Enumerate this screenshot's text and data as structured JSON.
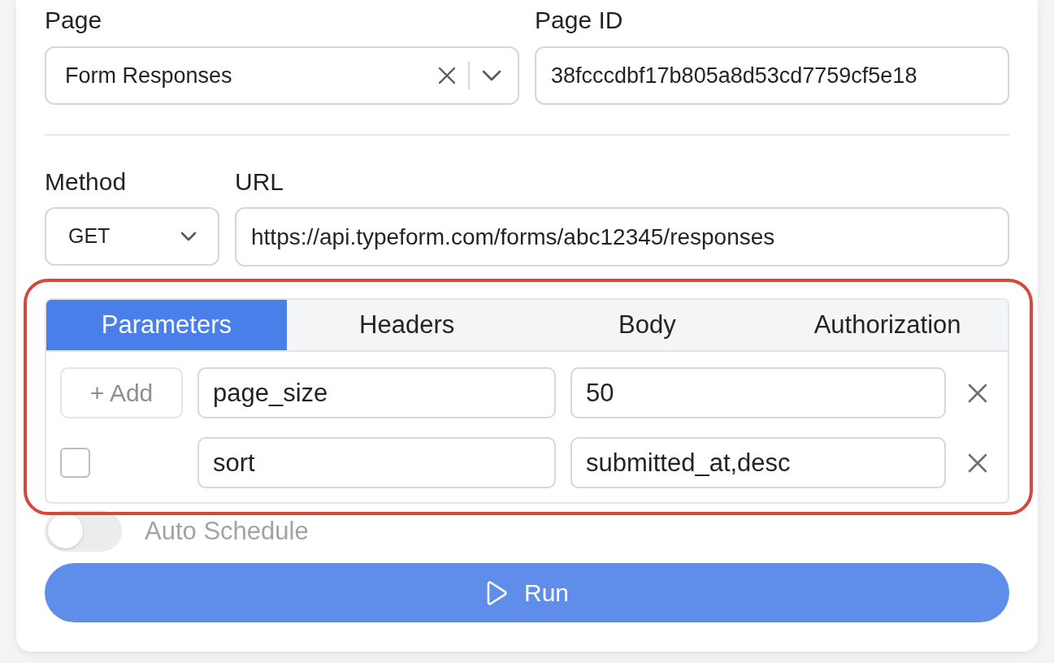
{
  "page_field": {
    "label": "Page",
    "value": "Form Responses"
  },
  "page_id_field": {
    "label": "Page ID",
    "value": "38fcccdbf17b805a8d53cd7759cf5e18"
  },
  "method_field": {
    "label": "Method",
    "value": "GET"
  },
  "url_field": {
    "label": "URL",
    "value": "https://api.typeform.com/forms/abc12345/responses"
  },
  "request_panel": {
    "highlighted": true,
    "tabs": [
      {
        "label": "Parameters",
        "selected": true
      },
      {
        "label": "Headers",
        "selected": false
      },
      {
        "label": "Body",
        "selected": false
      },
      {
        "label": "Authorization",
        "selected": false
      }
    ],
    "parameters": [
      {
        "kind": "add",
        "add_label": "+ Add",
        "key": "page_size",
        "value": "50"
      },
      {
        "kind": "check",
        "checked": false,
        "key": "sort",
        "value": "submitted_at,desc"
      }
    ]
  },
  "auto_schedule": {
    "label": "Auto Schedule",
    "on": false,
    "disabled": true
  },
  "run_button": {
    "label": "Run"
  }
}
